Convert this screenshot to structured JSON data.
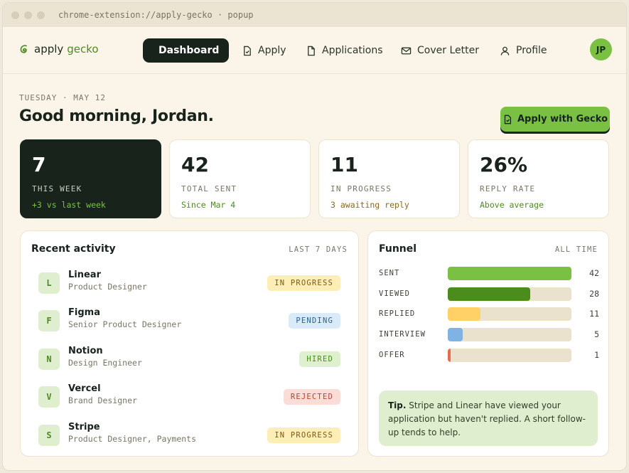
{
  "browser": {
    "url": "chrome-extension://apply-gecko · popup"
  },
  "brand": {
    "name_a": "apply",
    "name_b": "gecko"
  },
  "nav": {
    "items": [
      {
        "label": "Dashboard",
        "icon": "grid-icon"
      },
      {
        "label": "Apply",
        "icon": "file-check-icon"
      },
      {
        "label": "Applications",
        "icon": "file-icon"
      },
      {
        "label": "Cover Letter",
        "icon": "mail-icon"
      },
      {
        "label": "Profile",
        "icon": "user-icon"
      }
    ],
    "avatar": "JP"
  },
  "header": {
    "date": "TUESDAY · MAY 12",
    "greeting": "Good morning, Jordan.",
    "cta": "Apply with Gecko"
  },
  "stats": [
    {
      "value": "7",
      "label": "THIS WEEK",
      "sub": "+3 vs last week",
      "sub_color": "#7ac143"
    },
    {
      "value": "42",
      "label": "TOTAL SENT",
      "sub": "Since Mar 4",
      "sub_color": "#4c8b1e"
    },
    {
      "value": "11",
      "label": "IN PROGRESS",
      "sub": "3 awaiting reply",
      "sub_color": "#8a6a1a"
    },
    {
      "value": "26%",
      "label": "REPLY RATE",
      "sub": "Above average",
      "sub_color": "#4c8b1e"
    }
  ],
  "activity": {
    "title": "Recent activity",
    "range": "LAST 7 DAYS",
    "items": [
      {
        "initial": "L",
        "company": "Linear",
        "role": "Product Designer",
        "status": "IN PROGRESS",
        "bg": "#fdeeb8",
        "fg": "#7a5b0e"
      },
      {
        "initial": "F",
        "company": "Figma",
        "role": "Senior Product Designer",
        "status": "PENDING",
        "bg": "#d9ebf8",
        "fg": "#2f5f86"
      },
      {
        "initial": "N",
        "company": "Notion",
        "role": "Design Engineer",
        "status": "HIRED",
        "bg": "#dff0cf",
        "fg": "#4c8b1e"
      },
      {
        "initial": "V",
        "company": "Vercel",
        "role": "Brand Designer",
        "status": "REJECTED",
        "bg": "#fbdcd6",
        "fg": "#b2463a"
      },
      {
        "initial": "S",
        "company": "Stripe",
        "role": "Product Designer, Payments",
        "status": "IN PROGRESS",
        "bg": "#fdeeb8",
        "fg": "#7a5b0e"
      }
    ]
  },
  "funnel": {
    "title": "Funnel",
    "range": "ALL TIME",
    "max": 42,
    "stages": [
      {
        "label": "SENT",
        "count": 42,
        "color": "#7ac143"
      },
      {
        "label": "VIEWED",
        "count": 28,
        "color": "#4c8b1e"
      },
      {
        "label": "REPLIED",
        "count": 11,
        "color": "#ffd166"
      },
      {
        "label": "INTERVIEW",
        "count": 5,
        "color": "#7fb3e3"
      },
      {
        "label": "OFFER",
        "count": 1,
        "color": "#e66b4f"
      }
    ],
    "tip_label": "Tip.",
    "tip_text": " Stripe and Linear have viewed your application but haven't replied. A short follow-up tends to help."
  }
}
